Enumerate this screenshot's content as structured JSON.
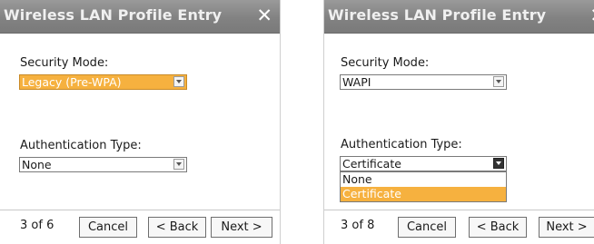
{
  "left": {
    "title": "Wireless LAN Profile Entry",
    "close_glyph": "✕",
    "security_label": "Security Mode:",
    "security_value": "Legacy (Pre-WPA)",
    "auth_label": "Authentication Type:",
    "auth_value": "None",
    "page_indicator": "3 of 6",
    "cancel": "Cancel",
    "back": "< Back",
    "next": "Next >"
  },
  "right": {
    "title": "Wireless LAN Profile Entry",
    "close_glyph": "✕",
    "security_label": "Security Mode:",
    "security_value": "WAPI",
    "auth_label": "Authentication Type:",
    "auth_value": "Certificate",
    "auth_options": [
      "None",
      "Certificate"
    ],
    "page_indicator": "3 of 8",
    "cancel": "Cancel",
    "back": "< Back",
    "next": "Next >"
  },
  "colors": {
    "selection": "#f6b13f",
    "titlebar": "#8a8a8a"
  }
}
